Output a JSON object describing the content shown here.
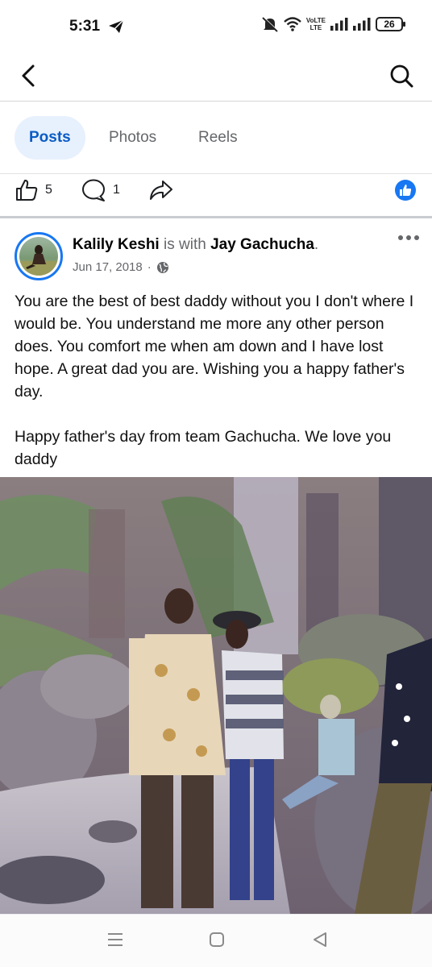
{
  "status_bar": {
    "time": "5:31",
    "network_top": "VoLTE",
    "network_bottom": "LTE",
    "battery": "26",
    "icons": [
      "telegram-send-icon",
      "mute-icon",
      "wifi-icon",
      "signal-icon",
      "signal-icon",
      "battery-icon"
    ]
  },
  "top_nav": {
    "back_icon": "chevron-left-icon",
    "search_icon": "search-icon"
  },
  "tabs": [
    {
      "label": "Posts",
      "active": true
    },
    {
      "label": "Photos",
      "active": false
    },
    {
      "label": "Reels",
      "active": false
    }
  ],
  "reactions_bar": {
    "like_count": "5",
    "comment_count": "1",
    "share_icon": "share-icon",
    "like_badge_icon": "thumbs-up-icon"
  },
  "post": {
    "author": "Kalily Keshi",
    "with_text": "is with",
    "tagged": "Jay Gachucha",
    "tagged_suffix": ".",
    "date": "Jun 17, 2018",
    "date_separator": "·",
    "privacy_icon": "globe-icon",
    "paragraphs": [
      "You are the best of best daddy without you I don't where I would be. You understand me more any other person does. You comfort me when am down and I have lost hope. A great dad you are. Wishing you a happy father's day.",
      "Happy father's day from team Gachucha. We love you daddy"
    ]
  },
  "nav_bar": {
    "icons": [
      "menu-icon",
      "home-square-icon",
      "back-triangle-icon"
    ]
  },
  "colors": {
    "accent": "#1877f2",
    "active_tab_bg": "#e7f0fd",
    "active_tab_text": "#0a5cc4",
    "muted_text": "#65676b"
  }
}
